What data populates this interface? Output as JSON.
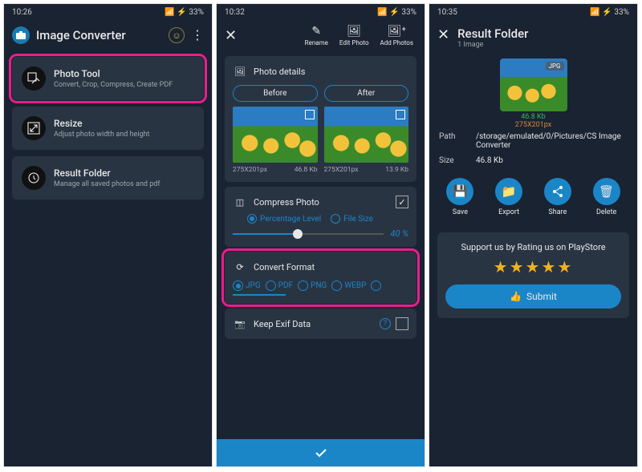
{
  "screen1": {
    "status": {
      "time": "10:26",
      "battery": "33%"
    },
    "app_title": "Image Converter",
    "cards": {
      "photo_tool": {
        "title": "Photo Tool",
        "subtitle": "Convert, Crop, Compress, Create PDF"
      },
      "resize": {
        "title": "Resize",
        "subtitle": "Adjust photo width and height"
      },
      "result": {
        "title": "Result Folder",
        "subtitle": "Manage all saved photos and pdf"
      }
    }
  },
  "screen2": {
    "status": {
      "time": "10:32",
      "battery": "33%"
    },
    "toolbar": {
      "rename": "Rename",
      "edit": "Edit Photo",
      "add": "Add Photos"
    },
    "details": {
      "title": "Photo details",
      "before": "Before",
      "after": "After",
      "before_dim": "275X201px",
      "before_size": "46.8 Kb",
      "after_dim": "275X201px",
      "after_size": "13.9 Kb"
    },
    "compress": {
      "title": "Compress Photo",
      "opt_percent": "Percentage Level",
      "opt_filesize": "File Size",
      "value": "40 %"
    },
    "format": {
      "title": "Convert Format",
      "opts": [
        "JPG",
        "PDF",
        "PNG",
        "WEBP"
      ]
    },
    "exif": {
      "title": "Keep Exif Data"
    }
  },
  "screen3": {
    "status": {
      "time": "10:35",
      "battery": "33%"
    },
    "header": {
      "title": "Result Folder",
      "subtitle": "1 Image"
    },
    "thumb": {
      "badge": "JPG",
      "size": "46.8 Kb",
      "dim": "275X201px"
    },
    "path": {
      "label": "Path",
      "value": "/storage/emulated/0/Pictures/CS Image Converter"
    },
    "size": {
      "label": "Size",
      "value": "46.8 Kb"
    },
    "actions": {
      "save": "Save",
      "export": "Export",
      "share": "Share",
      "delete": "Delete"
    },
    "rate": {
      "text": "Support us by Rating us on PlayStore",
      "submit": "Submit"
    }
  }
}
